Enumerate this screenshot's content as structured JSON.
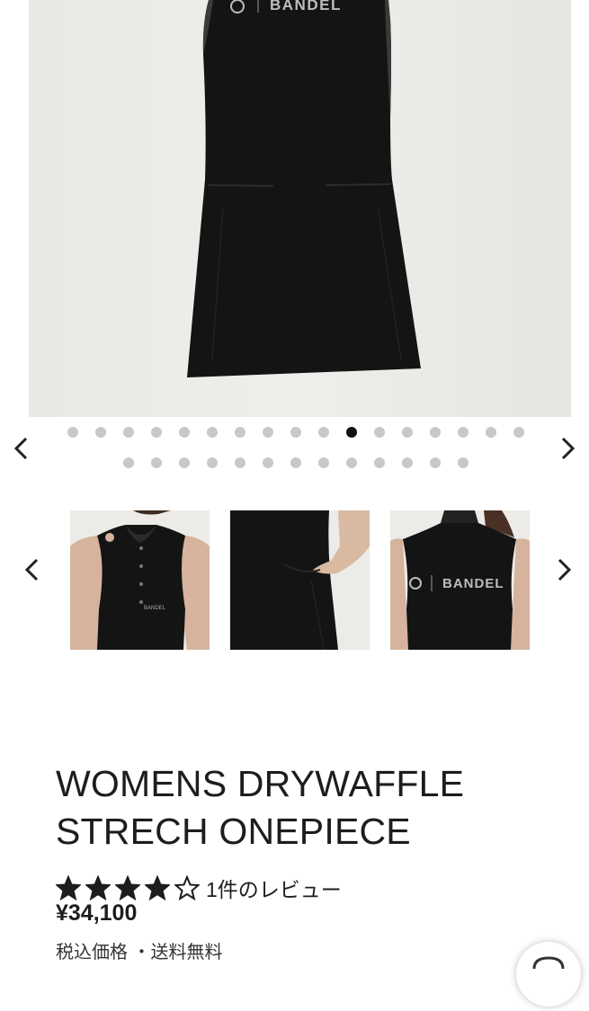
{
  "gallery": {
    "hero_alt": "BANDEL",
    "hero_logo_text": "BANDEL",
    "dots_row1_count": 17,
    "dots_row2_count": 13,
    "active_dot_index": 10,
    "prev_icon": "chevron-left-icon",
    "next_icon": "chevron-right-icon"
  },
  "thumbnails": {
    "items": [
      {
        "logo_text": "BANDEL"
      },
      {
        "logo_text": ""
      },
      {
        "logo_text": "BANDEL"
      }
    ]
  },
  "product": {
    "title_line1": "WOMENS DRYWAFFLE",
    "title_line2": "STRECH ONEPIECE",
    "rating_value": 4,
    "rating_max": 5,
    "review_text": "1件のレビュー",
    "price": "¥34,100",
    "tax_note": "税込価格 ・送料無料"
  },
  "colors": {
    "dot_inactive": "#c8c8c8",
    "dot_active": "#111111",
    "text": "#1d1d1d"
  }
}
